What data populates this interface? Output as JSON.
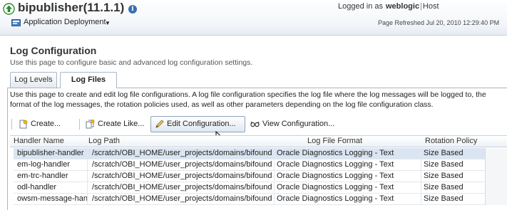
{
  "header": {
    "app_title": "bipublisher(11.1.1)",
    "info_glyph": "i",
    "deployment_menu": "Application Deployment",
    "logged_in_prefix": "Logged in as",
    "user": "weblogic",
    "separator": "|",
    "host_label": "Host",
    "page_refreshed": "Page Refreshed Jul 20, 2010 12:29:40 PM",
    "icons": [
      "up-arrow-icon",
      "info-icon",
      "deployment-icon",
      "chevron-down-icon"
    ]
  },
  "page": {
    "title": "Log Configuration",
    "subtitle": "Use this page to configure basic and advanced log configuration settings."
  },
  "tabs": [
    {
      "label": "Log Levels",
      "selected": false
    },
    {
      "label": "Log Files",
      "selected": true
    }
  ],
  "description": "Use this page to create and edit log file configurations. A log file configuration specifies the log file where the log messages will be logged to, the format of the log messages, the rotation policies used, as well as other parameters depending on the log file configuration class.",
  "toolbar": {
    "create": "Create...",
    "create_like": "Create Like...",
    "edit_configuration": "Edit Configuration...",
    "view_configuration": "View Configuration...",
    "icons": [
      "create-icon",
      "create-like-icon",
      "pencil-icon",
      "glasses-icon"
    ]
  },
  "table": {
    "columns": [
      "Handler Name",
      "Log Path",
      "Log File Format",
      "Rotation Policy"
    ],
    "rows": [
      {
        "handler": "bipublisher-handler",
        "path": "/scratch/OBI_HOME/user_projects/domains/bifoundation_domain",
        "format": "Oracle Diagnostics Logging - Text",
        "policy": "Size Based",
        "selected": true
      },
      {
        "handler": "em-log-handler",
        "path": "/scratch/OBI_HOME/user_projects/domains/bifoundation_domain",
        "format": "Oracle Diagnostics Logging - Text",
        "policy": "Size Based",
        "selected": false
      },
      {
        "handler": "em-trc-handler",
        "path": "/scratch/OBI_HOME/user_projects/domains/bifoundation_domain",
        "format": "Oracle Diagnostics Logging - Text",
        "policy": "Size Based",
        "selected": false
      },
      {
        "handler": "odl-handler",
        "path": "/scratch/OBI_HOME/user_projects/domains/bifoundation_domain",
        "format": "Oracle Diagnostics Logging - Text",
        "policy": "Size Based",
        "selected": false
      },
      {
        "handler": "owsm-message-handler",
        "path": "/scratch/OBI_HOME/user_projects/domains/bifoundation_domain",
        "format": "Oracle Diagnostics Logging - Text",
        "policy": "Size Based",
        "selected": false
      }
    ]
  },
  "colors": {
    "accent": "#3a6fb3",
    "selected_row": "#dbe5f1",
    "up_arrow": "#2e8b2e"
  }
}
